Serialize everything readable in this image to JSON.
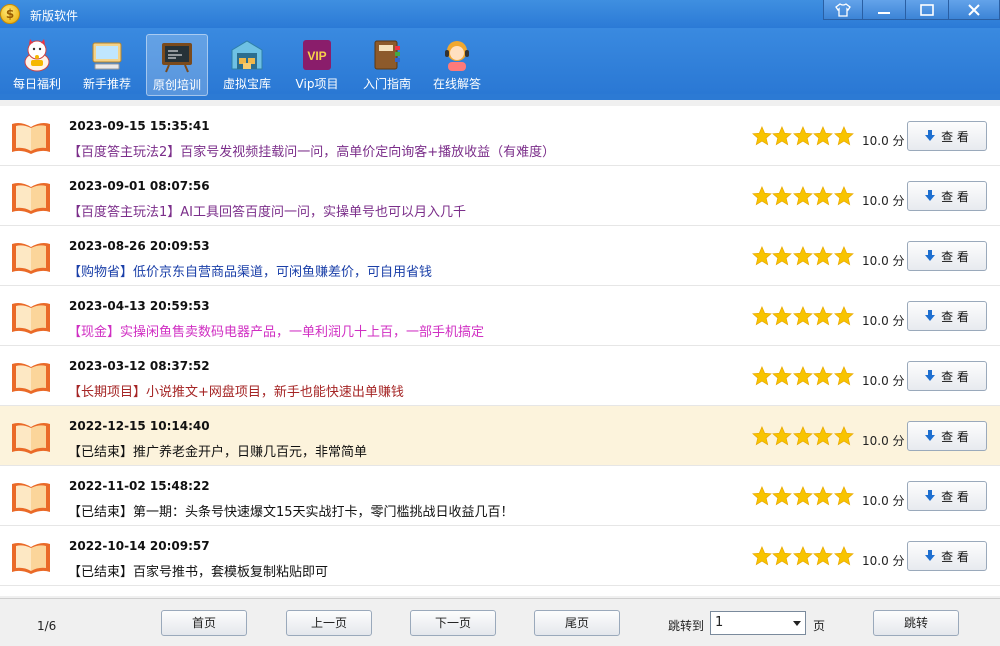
{
  "window": {
    "title": "新版软件",
    "controls": [
      "skin",
      "minimize",
      "maximize",
      "close"
    ]
  },
  "toolbar": {
    "items": [
      {
        "label": "每日福利",
        "icon": "lucky-cat-icon"
      },
      {
        "label": "新手推荐",
        "icon": "monitor-icon"
      },
      {
        "label": "原创培训",
        "icon": "training-board-icon",
        "active": true
      },
      {
        "label": "虚拟宝库",
        "icon": "warehouse-icon"
      },
      {
        "label": "Vip项目",
        "icon": "vip-icon",
        "icon_text": "VIP"
      },
      {
        "label": "入门指南",
        "icon": "guide-book-icon"
      },
      {
        "label": "在线解答",
        "icon": "support-agent-icon"
      }
    ]
  },
  "list": {
    "rows": [
      {
        "date": "2023-09-15 15:35:41",
        "title": "【百度答主玩法2】百家号发视频挂载问一问，高单价定向询客+播放收益（有难度）",
        "color": "#7b2e8a",
        "score": "10.0 分",
        "rating": 5,
        "button": "查 看"
      },
      {
        "date": "2023-09-01 08:07:56",
        "title": "【百度答主玩法1】AI工具回答百度问一问，实操单号也可以月入几千",
        "color": "#7b2e8a",
        "score": "10.0 分",
        "rating": 5,
        "button": "查 看"
      },
      {
        "date": "2023-08-26 20:09:53",
        "title": "【购物省】低价京东自营商品渠道，可闲鱼赚差价，可自用省钱",
        "color": "#1a3fa8",
        "score": "10.0 分",
        "rating": 5,
        "button": "查 看"
      },
      {
        "date": "2023-04-13 20:59:53",
        "title": "【现金】实操闲鱼售卖数码电器产品，一单利润几十上百，一部手机搞定",
        "color": "#d02fc3",
        "score": "10.0 分",
        "rating": 5,
        "button": "查 看"
      },
      {
        "date": "2023-03-12 08:37:52",
        "title": "【长期项目】小说推文+网盘项目，新手也能快速出单赚钱",
        "color": "#a52525",
        "score": "10.0 分",
        "rating": 5,
        "button": "查 看"
      },
      {
        "date": "2022-12-15 10:14:40",
        "title": "【已结束】推广养老金开户，日赚几百元，非常简单",
        "color": "#111111",
        "score": "10.0 分",
        "rating": 5,
        "button": "查 看",
        "highlight": true
      },
      {
        "date": "2022-11-02 15:48:22",
        "title": "【已结束】第一期：头条号快速爆文15天实战打卡，零门槛挑战日收益几百！",
        "color": "#111111",
        "score": "10.0 分",
        "rating": 5,
        "button": "查 看"
      },
      {
        "date": "2022-10-14 20:09:57",
        "title": "【已结束】百家号推书，套模板复制粘贴即可",
        "color": "#111111",
        "score": "10.0 分",
        "rating": 5,
        "button": "查 看"
      }
    ]
  },
  "footer": {
    "page_info": "1/6",
    "first": "首页",
    "prev": "上一页",
    "next": "下一页",
    "last": "尾页",
    "jump_to": "跳转到",
    "page_value": "1",
    "page_unit": "页",
    "jump": "跳转"
  }
}
